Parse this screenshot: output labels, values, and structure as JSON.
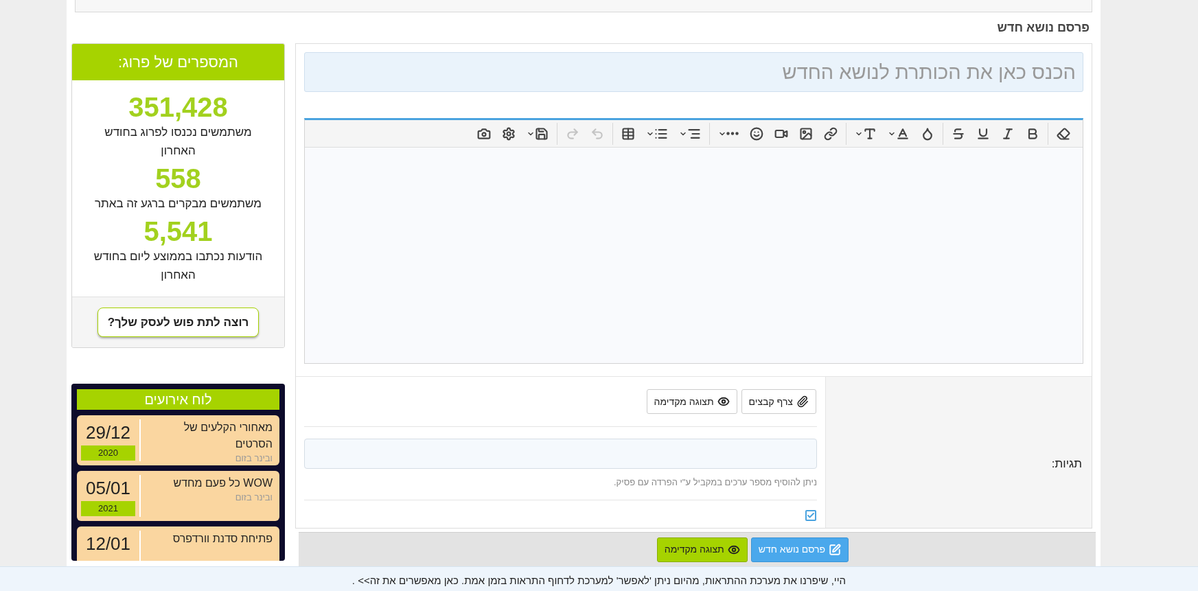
{
  "page_title": "פרסם נושא חדש",
  "stats": {
    "title": "המספרים של פרוג:",
    "items": [
      {
        "value": "351,428",
        "label": "משתמשים נכנסו לפרוג בחודש האחרון"
      },
      {
        "value": "558",
        "label": "משתמשים מבקרים ברגע זה באתר"
      },
      {
        "value": "5,541",
        "label": "הודעות נכתבו בממוצע ליום בחודש האחרון"
      }
    ],
    "button": "רוצה לתת פוש לעסק שלך?"
  },
  "events": {
    "title": "לוח אירועים",
    "items": [
      {
        "date": "29/12",
        "year": "2020",
        "title": "מאחורי הקלעים של הסרטים",
        "type": "ובינר בזום"
      },
      {
        "date": "05/01",
        "year": "2021",
        "title": "WOW כל פעם מחדש",
        "type": "ובינר בזום"
      },
      {
        "date": "12/01",
        "title": "פתיחת סדנת וורדפרס"
      }
    ]
  },
  "editor": {
    "title_placeholder": "הכנס כאן את הכותרת לנושא החדש",
    "toolbar": [
      [
        {
          "kind": "eraser",
          "disabled": false
        }
      ],
      [
        {
          "kind": "bold",
          "disabled": false
        },
        {
          "kind": "italic",
          "disabled": false
        },
        {
          "kind": "underline",
          "disabled": false
        },
        {
          "kind": "strike",
          "disabled": false
        }
      ],
      [
        {
          "kind": "color",
          "disabled": false
        },
        {
          "kind": "font",
          "disabled": false
        },
        {
          "kind": "size",
          "disabled": false
        }
      ],
      [
        {
          "kind": "link",
          "disabled": false
        },
        {
          "kind": "image",
          "disabled": false
        },
        {
          "kind": "video",
          "disabled": false
        },
        {
          "kind": "smilie",
          "disabled": false
        },
        {
          "kind": "more",
          "disabled": false
        }
      ],
      [
        {
          "kind": "align",
          "disabled": false
        },
        {
          "kind": "list",
          "disabled": false
        },
        {
          "kind": "table",
          "disabled": false
        }
      ],
      [
        {
          "kind": "undo",
          "disabled": true
        },
        {
          "kind": "redo",
          "disabled": true
        }
      ],
      [
        {
          "kind": "save",
          "disabled": false
        },
        {
          "kind": "settings",
          "disabled": false
        },
        {
          "kind": "camera",
          "disabled": false
        }
      ]
    ]
  },
  "attach_button": "צרף קבצים",
  "preview_button": "תצוגה מקדימה",
  "tags": {
    "label": "תגיות:",
    "hint": "ניתן להוסיף מספר ערכים במקביל ע\"י הפרדה עם פסיק."
  },
  "options": {
    "watch_checked": true
  },
  "footer": {
    "submit": "פרסם נושא חדש",
    "preview": "תצוגה מקדימה"
  },
  "notice": "היי, שיפרנו את מערכת ההתראות, מהיום ניתן 'לאפשר' למערכת לדחוף התראות בזמן אמת. כאן מאפשרים את זה>> ."
}
